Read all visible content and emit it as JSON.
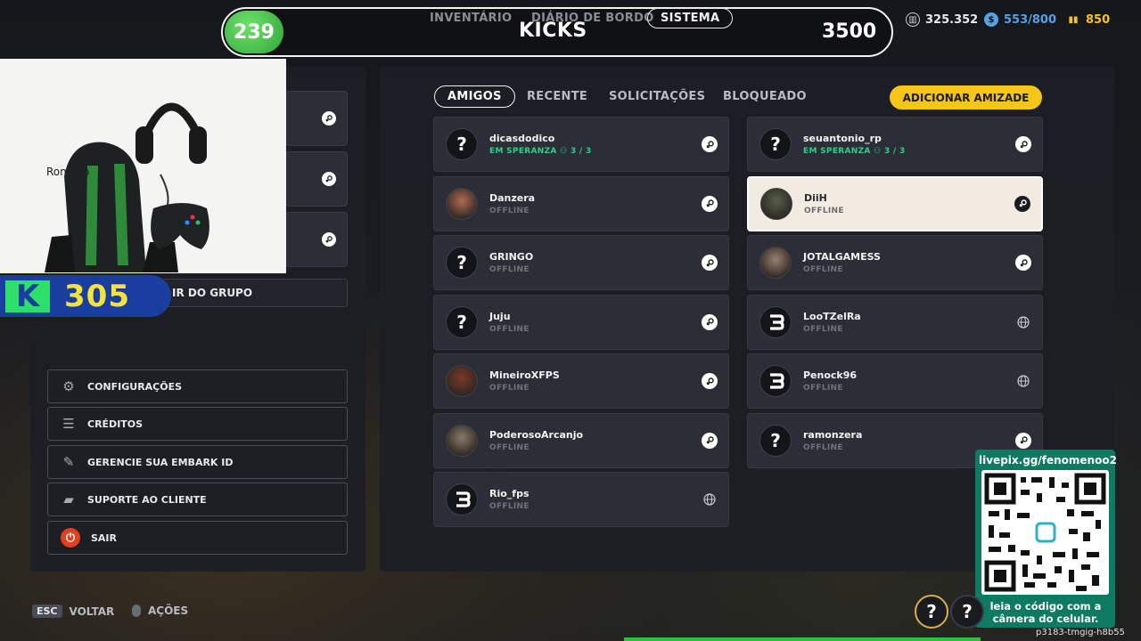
{
  "header": {
    "level": "239",
    "tabs": [
      {
        "label": "INVENTÁRIO",
        "active": false
      },
      {
        "label": "DIÁRIO DE BORDO",
        "active": false
      },
      {
        "label": "SISTEMA",
        "active": true
      }
    ],
    "title": "KICKS",
    "kicks_value": "3500",
    "currencies": [
      {
        "icon": "coins-icon",
        "value": "325.352",
        "color": "#e8e9ee"
      },
      {
        "icon": "token-icon",
        "value": "553/800",
        "color": "#5aa0e0"
      },
      {
        "icon": "multibucks-icon",
        "value": "850",
        "color": "#f5c518"
      }
    ]
  },
  "left": {
    "group_button": "IR DO GRUPO",
    "menu": [
      {
        "label": "CONFIGURAÇÕES",
        "icon": "gear-icon"
      },
      {
        "label": "CRÉDITOS",
        "icon": "list-icon"
      },
      {
        "label": "GERENCIE SUA EMBARK ID",
        "icon": "user-edit-icon"
      },
      {
        "label": "SUPORTE AO CLIENTE",
        "icon": "chat-icon"
      },
      {
        "label": "SAIR",
        "icon": "power-icon"
      }
    ]
  },
  "webcam": {
    "name": "Ronaldo",
    "badge_number": "305"
  },
  "friends": {
    "tabs": [
      {
        "label": "AMIGOS",
        "active": true
      },
      {
        "label": "RECENTE",
        "active": false
      },
      {
        "label": "SOLICITAÇÕES",
        "active": false
      },
      {
        "label": "BLOQUEADO",
        "active": false
      }
    ],
    "add_button": "ADICIONAR AMIZADE",
    "left_column": [
      {
        "name": "dicasdodico",
        "status": "EM SPERANZA",
        "party": "3 / 3",
        "online": true,
        "avatar": "?",
        "platform": "steam"
      },
      {
        "name": "Danzera",
        "status": "OFFLINE",
        "online": false,
        "avatar": "photo",
        "platform": "steam"
      },
      {
        "name": "GRINGO",
        "status": "OFFLINE",
        "online": false,
        "avatar": "?",
        "platform": "steam"
      },
      {
        "name": "Juju",
        "status": "OFFLINE",
        "online": false,
        "avatar": "?",
        "platform": "steam"
      },
      {
        "name": "MineiroXFPS",
        "status": "OFFLINE",
        "online": false,
        "avatar": "photo",
        "platform": "steam"
      },
      {
        "name": "PoderosoArcanjo",
        "status": "OFFLINE",
        "online": false,
        "avatar": "photo",
        "platform": "steam"
      },
      {
        "name": "Rio_fps",
        "status": "OFFLINE",
        "online": false,
        "avatar": "embark",
        "platform": "globe"
      }
    ],
    "right_column": [
      {
        "name": "seuantonio_rp",
        "status": "EM SPERANZA",
        "party": "3 / 3",
        "online": true,
        "avatar": "?",
        "platform": "steam"
      },
      {
        "name": "DiiH",
        "status": "OFFLINE",
        "online": false,
        "avatar": "photo",
        "platform": "steam",
        "selected": true
      },
      {
        "name": "JOTALGAMESS",
        "status": "OFFLINE",
        "online": false,
        "avatar": "photo",
        "platform": "steam"
      },
      {
        "name": "LooTZelRa",
        "status": "OFFLINE",
        "online": false,
        "avatar": "embark",
        "platform": "globe"
      },
      {
        "name": "Penock96",
        "status": "OFFLINE",
        "online": false,
        "avatar": "embark",
        "platform": "globe"
      },
      {
        "name": "ramonzera",
        "status": "OFFLINE",
        "online": false,
        "avatar": "?",
        "platform": "steam"
      }
    ]
  },
  "qr": {
    "url": "livepix.gg/fenomenoo2",
    "caption_line1": "leia o código com a",
    "caption_line2": "câmera do celular."
  },
  "footer": {
    "esc_key": "ESC",
    "back_label": "VOLTAR",
    "actions_label": "AÇÕES",
    "session_id": "p3183-tmgig-h8b55"
  }
}
